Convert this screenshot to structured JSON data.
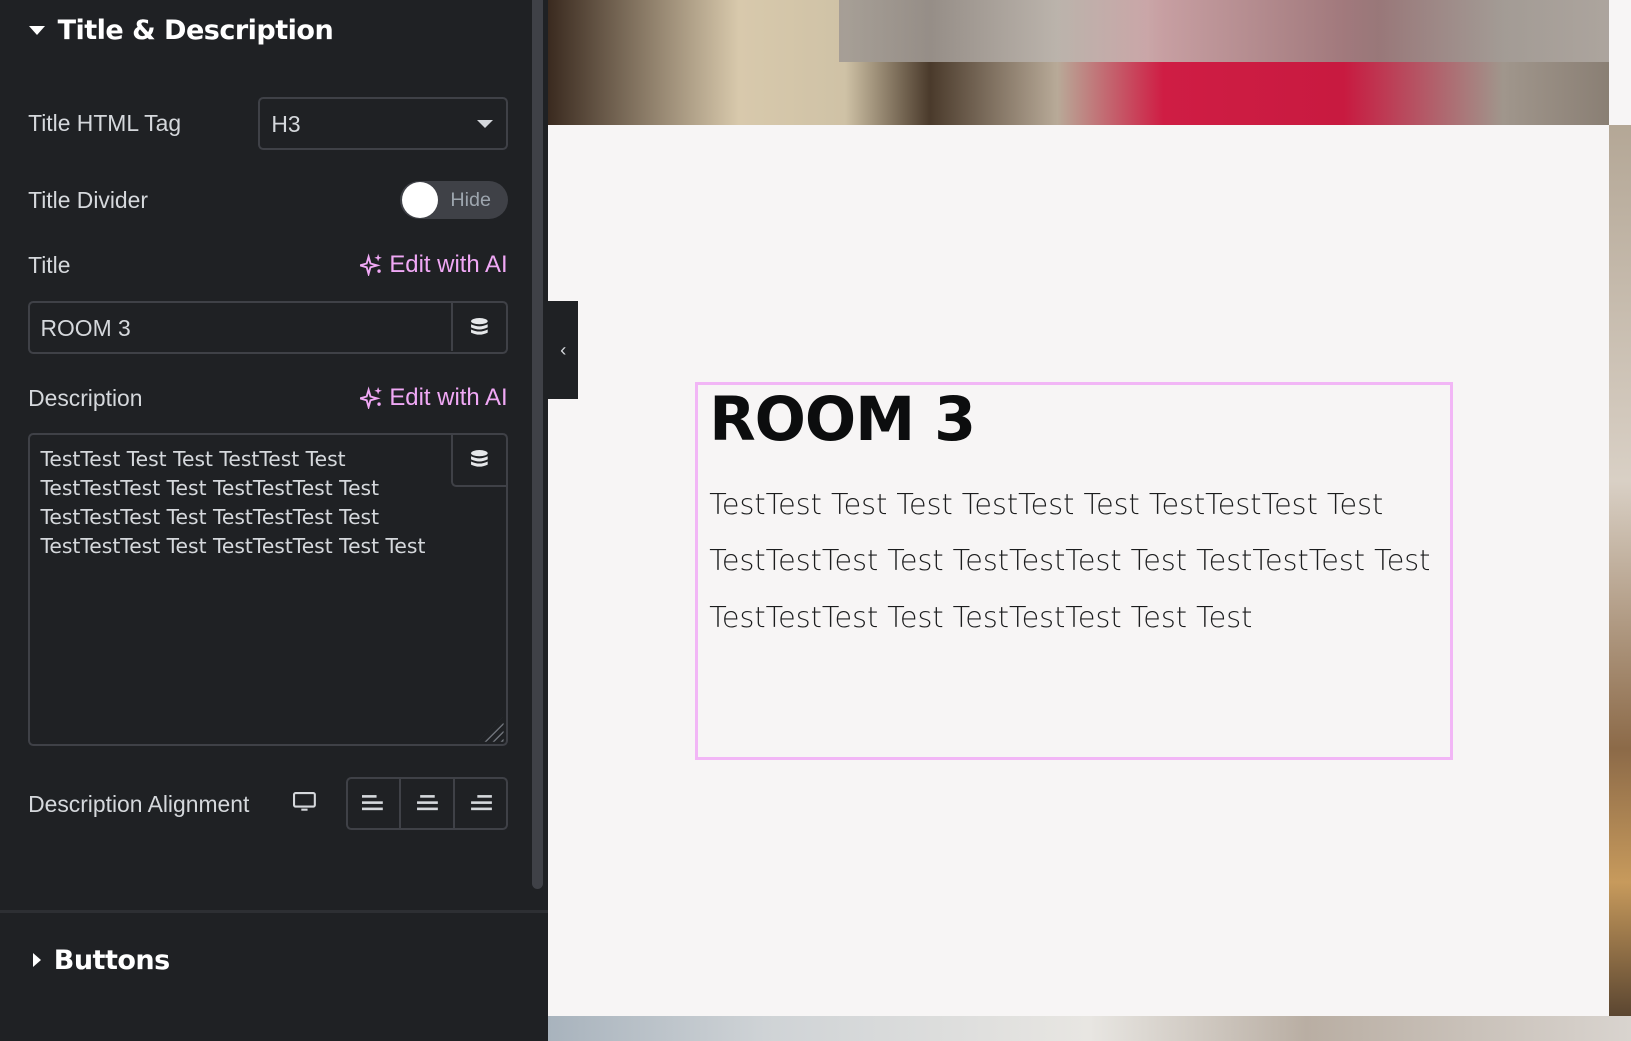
{
  "panel": {
    "section_title": "Title & Description",
    "title_html_tag": {
      "label": "Title HTML Tag",
      "value": "H3"
    },
    "title_divider": {
      "label": "Title Divider",
      "state": "Hide"
    },
    "title": {
      "label": "Title",
      "ai_label": "Edit with AI",
      "value": "ROOM 3"
    },
    "description": {
      "label": "Description",
      "ai_label": "Edit with AI",
      "value": "TestTest Test Test TestTest Test TestTestTest Test TestTestTest Test TestTestTest Test TestTestTest Test TestTestTest Test TestTestTest Test Test"
    },
    "description_alignment": {
      "label": "Description Alignment",
      "options": [
        "left",
        "center",
        "right"
      ]
    },
    "next_section": "Buttons"
  },
  "canvas": {
    "widget_title": "ROOM 3",
    "widget_description": "TestTest Test Test TestTest Test TestTestTest Test TestTestTest Test TestTestTest Test TestTestTest Test TestTestTest Test TestTestTest Test Test"
  },
  "colors": {
    "panel_bg": "#1f2124",
    "accent_ai": "#f0a8f5",
    "selection_border": "#f2b6f6",
    "canvas_bg": "#f7f5f5"
  }
}
